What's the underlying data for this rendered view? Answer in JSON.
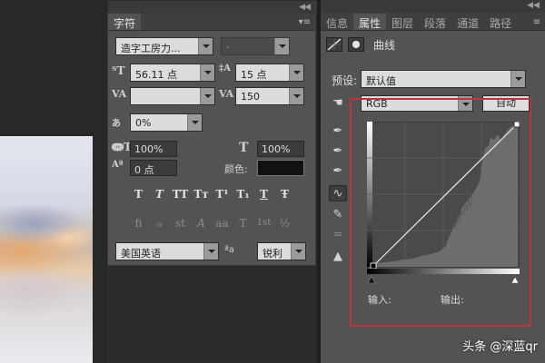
{
  "colors": {
    "panel_bg": "#535353",
    "highlight_frame": "#c0333a",
    "text_color_swatch": "#111111"
  },
  "character_panel": {
    "tab": "字符",
    "menu_icon": "panel-menu-icon",
    "font_family": "造字工房力...",
    "font_style": "-",
    "font_size": "56.11 点",
    "leading": "15 点",
    "kerning": "",
    "tracking": "150",
    "tsume": "0%",
    "vertical_scale": "100%",
    "horizontal_scale": "100%",
    "baseline_shift": "0 点",
    "color_label": "颜色:",
    "style_buttons": [
      "T",
      "T",
      "TT",
      "Tт",
      "T¹",
      "T₁",
      "T",
      "Ŧ"
    ],
    "opentype_buttons": [
      "fi",
      "ℴ",
      "st",
      "A",
      "aa",
      "T",
      "1st",
      "½"
    ],
    "language": "美国英语",
    "aa_label": "ªa",
    "antialias": "锐利"
  },
  "properties_panel": {
    "tabs": [
      "信息",
      "属性",
      "图层",
      "段落",
      "通道",
      "路径"
    ],
    "active_tab": "属性",
    "header_title": "曲线",
    "preset_label": "预设:",
    "preset_value": "默认值",
    "channel_value": "RGB",
    "auto_button": "自动",
    "input_label": "输入:",
    "output_label": "输出:"
  },
  "tools": [
    "on-image-icon",
    "eyedropper-black-icon",
    "eyedropper-gray-icon",
    "eyedropper-white-icon",
    "curve-edit-icon",
    "pencil-icon",
    "smooth-icon",
    "clipping-warning-icon"
  ],
  "watermark": "头条 @深蓝qr"
}
